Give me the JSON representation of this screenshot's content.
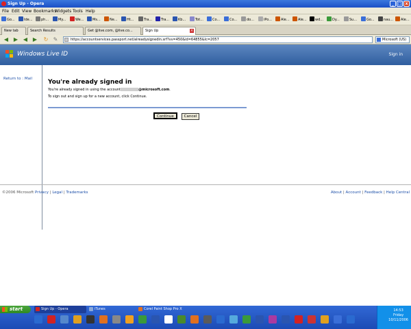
{
  "window": {
    "title": "Sign Up - Opera",
    "minimize": "_",
    "maximize": "□",
    "close": "x"
  },
  "menu": [
    "File",
    "Edit",
    "View",
    "Bookmarks",
    "Widgets",
    "Tools",
    "Help"
  ],
  "bookmarks": [
    {
      "label": "Go...",
      "color": "#3a6ed8"
    },
    {
      "label": "Ide...",
      "color": "#2a55b0"
    },
    {
      "label": "ph...",
      "color": "#777777"
    },
    {
      "label": "My...",
      "color": "#2a55b0"
    },
    {
      "label": "We...",
      "color": "#d22222"
    },
    {
      "label": "Ms...",
      "color": "#2a55b0"
    },
    {
      "label": "Ne...",
      "color": "#cc5500"
    },
    {
      "label": "Ht...",
      "color": "#2a55b0"
    },
    {
      "label": "Tra...",
      "color": "#666666"
    },
    {
      "label": "Tra...",
      "color": "#2222aa"
    },
    {
      "label": "Kb...",
      "color": "#2a55b0"
    },
    {
      "label": "Tot...",
      "color": "#8888cc"
    },
    {
      "label": "Co...",
      "color": "#3a6ed8"
    },
    {
      "label": "Co...",
      "color": "#3a6ed8"
    },
    {
      "label": "do...",
      "color": "#999999"
    },
    {
      "label": "iPo...",
      "color": "#aaaaaa"
    },
    {
      "label": "Ale...",
      "color": "#cc5500"
    },
    {
      "label": "Ale...",
      "color": "#cc5500"
    },
    {
      "label": "wd...",
      "color": "#000000"
    },
    {
      "label": "Dy...",
      "color": "#3a9a3a"
    },
    {
      "label": "Su...",
      "color": "#999999"
    },
    {
      "label": "Go...",
      "color": "#3a6ed8"
    },
    {
      "label": "nau...",
      "color": "#444444"
    },
    {
      "label": "Ale...",
      "color": "#cc5500"
    }
  ],
  "tabs": [
    {
      "label": "New tab",
      "active": false
    },
    {
      "label": "Search Results",
      "active": false
    },
    {
      "label": "Get @live.com, @live.co...",
      "active": false
    },
    {
      "label": "Sign Up",
      "active": true
    }
  ],
  "address": {
    "url": "https://accountservices.passport.net/alreadysignedin.srf?vv=450&id=64855&lc=2057",
    "search_engine": "Microsoft (US)"
  },
  "header": {
    "brand": "Windows Live ID",
    "sign_in": "Sign in"
  },
  "nav": {
    "return_link": "Return to : Mail"
  },
  "content": {
    "heading": "You're already signed in",
    "line1_prefix": "You're already signed in using the account",
    "line1_domain": "@microsoft.com",
    "line1_suffix": ".",
    "line2": "To sign out and sign up for a new account, click Continue.",
    "continue": "Continue",
    "cancel": "Cancel"
  },
  "footer": {
    "copyright": "©2006 Microsoft",
    "left_links": [
      "Privacy",
      "Legal",
      "Trademarks"
    ],
    "right_links": [
      "About",
      "Account",
      "Feedback",
      "Help Central"
    ]
  },
  "taskbar": {
    "start": "start",
    "items": [
      {
        "label": "Sign Up - Opera",
        "active": true,
        "color": "#d22222"
      },
      {
        "label": "iTunes",
        "active": false,
        "color": "#8aa8d8"
      },
      {
        "label": "Corel Paint Shop Pro X",
        "active": false,
        "color": "#e07020"
      }
    ],
    "quicklaunch_colors": [
      "#2a6ad0",
      "#d22222",
      "#5588cc",
      "#e0a020",
      "#333333",
      "#e07020",
      "#888888",
      "#f0a020",
      "#3a9a3a",
      "#2a55b0",
      "#ffffff",
      "#4a8a2a",
      "#e07020",
      "#5a5a5a",
      "#2a6ad0",
      "#55aadd",
      "#3a9a3a",
      "#2a55b0",
      "#aa3aa0",
      "#2a55b0",
      "#d22222",
      "#cc3333",
      "#e0a020",
      "#3a6ed8",
      "#2a6ad0"
    ],
    "clock": {
      "time": "14:53",
      "day": "Friday",
      "date": "10/11/2006"
    }
  }
}
